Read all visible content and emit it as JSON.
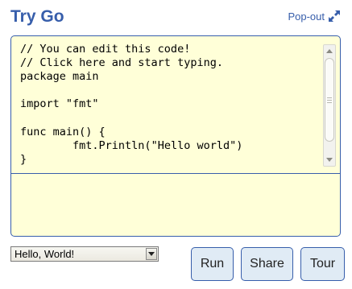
{
  "header": {
    "title": "Try Go",
    "popout_label": "Pop-out",
    "popout_icon": "expand-arrows-icon"
  },
  "editor": {
    "code": "// You can edit this code!\n// Click here and start typing.\npackage main\n\nimport \"fmt\"\n\nfunc main() {\n\tfmt.Println(\"Hello world\")\n}",
    "output": ""
  },
  "examples": {
    "selected": "Hello, World!"
  },
  "actions": {
    "run_label": "Run",
    "share_label": "Share",
    "tour_label": "Tour"
  },
  "colors": {
    "accent": "#375eab",
    "editor_bg": "#ffffd8",
    "button_bg": "#e0ebf5"
  }
}
